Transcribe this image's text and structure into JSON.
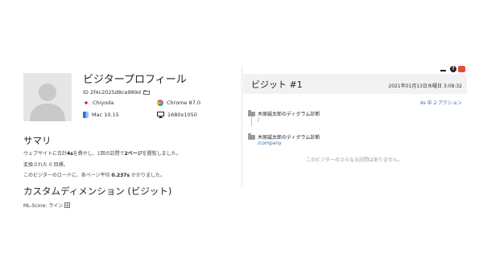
{
  "profile": {
    "title": "ビジタープロフィール",
    "visitor_id": "ID 2f4c2025d8ce989d",
    "location": "Chiyoda",
    "browser": "Chrome 87.0",
    "os": "Mac 10.15",
    "resolution": "1680x1050"
  },
  "summary": {
    "heading": "サマリ",
    "line1": {
      "pre": "ウェブサイトに合計",
      "time": "4s",
      "mid": "を費やし、1回の訪問で",
      "pages": "2ページ",
      "post": "を閲覧しました。"
    },
    "line2": "変換された 0 目標。",
    "line3": {
      "pre": "このビジターのロードに、各ページ平均 ",
      "avg": "0.237s",
      "post": " かかりました。"
    }
  },
  "custom": {
    "heading": "カスタムディメンション (ビジット)",
    "ml_score": "ML-Score: ライン"
  },
  "visit": {
    "title": "ビジット #1",
    "date": "2021年01月13日水曜日 3:08:32",
    "action_summary": "4s 中 2 アクション",
    "pages": [
      {
        "title": "木原誠太郎のディグラム診断",
        "url": "/"
      },
      {
        "title": "木原誠太郎のディグラム診断",
        "url": "/company"
      }
    ],
    "no_more": "このビジターのさらなる訪問はありません。"
  },
  "colors": {
    "accent": "#3a6ea5",
    "close": "#e74c3c"
  }
}
